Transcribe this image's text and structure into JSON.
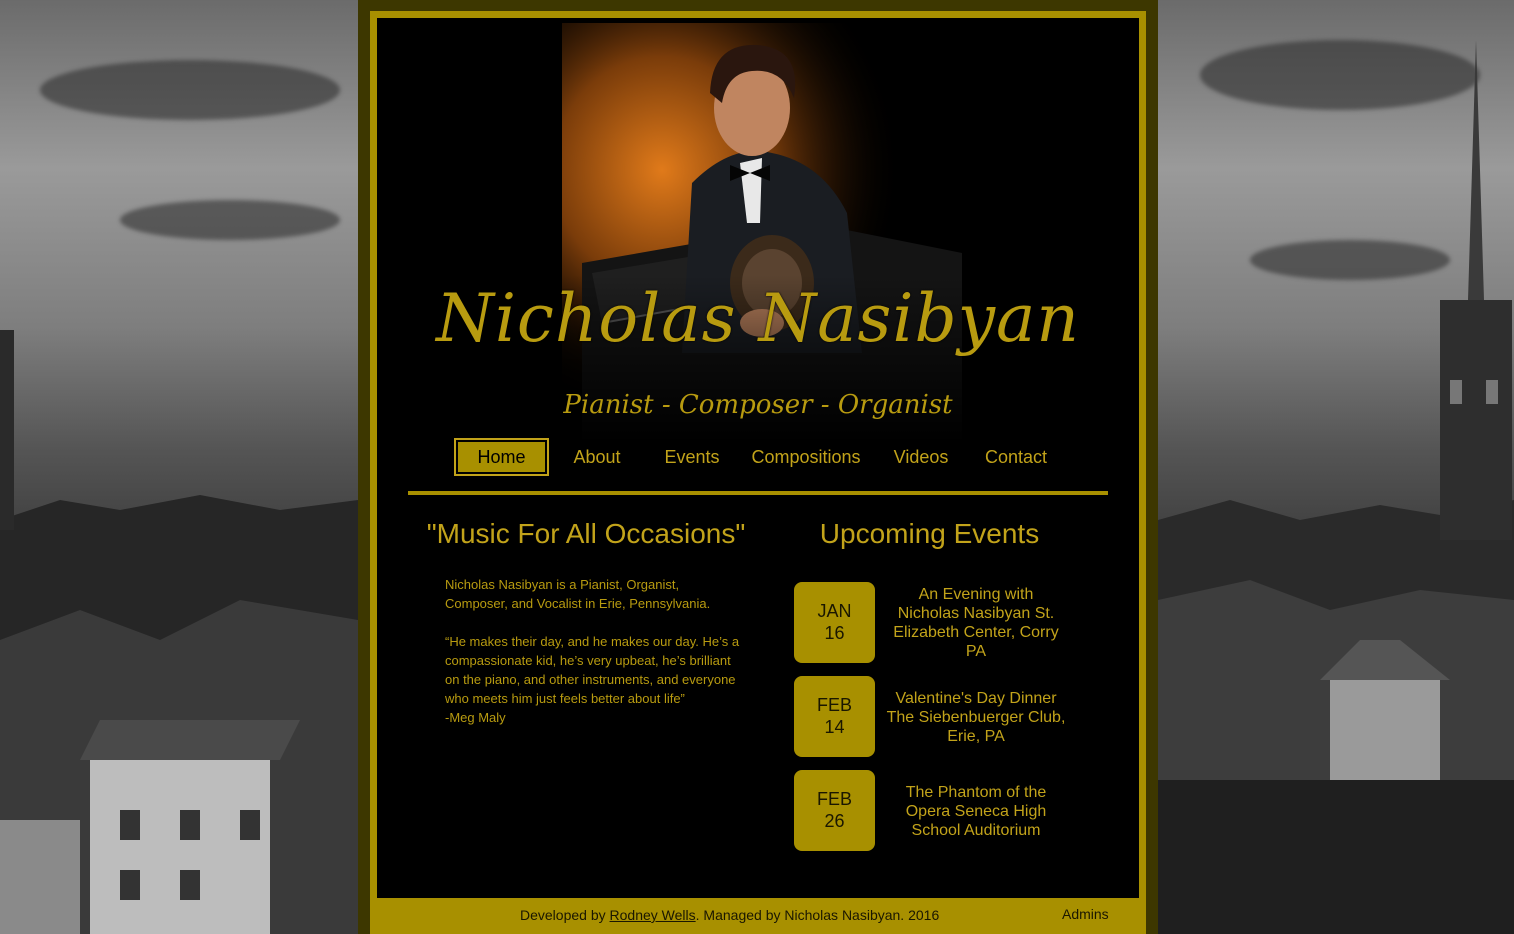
{
  "site": {
    "title": "Nicholas Nasibyan",
    "subtitle": "Pianist - Composer - Organist"
  },
  "nav": {
    "items": [
      {
        "label": "Home",
        "active": true
      },
      {
        "label": "About"
      },
      {
        "label": "Events"
      },
      {
        "label": "Compositions"
      },
      {
        "label": "Videos"
      },
      {
        "label": "Contact"
      }
    ]
  },
  "left": {
    "heading": "\"Music For All Occasions\"",
    "intro": "Nicholas Nasibyan is a Pianist, Organist, Composer, and Vocalist in Erie, Pennsylvania.",
    "quote": "“He makes their day, and he makes our day. He’s a compassionate kid, he’s very upbeat, he’s brilliant on the piano, and other instruments, and everyone who meets him just feels better about life”",
    "attribution": "-Meg Maly"
  },
  "events": {
    "heading": "Upcoming Events",
    "items": [
      {
        "month": "JAN",
        "day": "16",
        "title": "An Evening with Nicholas Nasibyan St. Elizabeth Center, Corry PA"
      },
      {
        "month": "FEB",
        "day": "14",
        "title": "Valentine's Day Dinner The Siebenbuerger Club, Erie, PA"
      },
      {
        "month": "FEB",
        "day": "26",
        "title": "The Phantom of the Opera Seneca High School Auditorium"
      }
    ]
  },
  "footer": {
    "developed_prefix": "Developed by ",
    "developer": "Rodney Wells",
    "managed": ". Managed by Nicholas Nasibyan. 2016",
    "admins": "Admins"
  },
  "colors": {
    "gold": "#a89000",
    "text_gold": "#c2a31a",
    "background": "#000000"
  }
}
